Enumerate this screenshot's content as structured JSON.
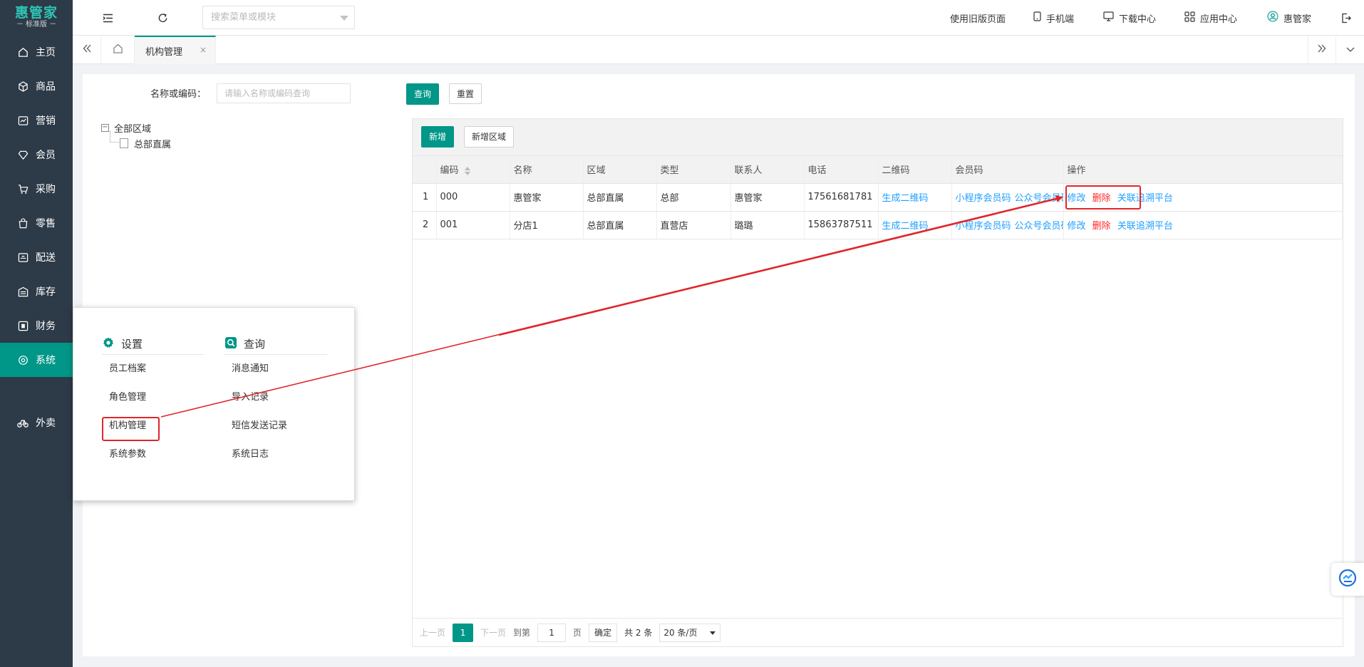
{
  "sidebar": {
    "logo": {
      "name": "惠管家",
      "edition": "－ 标准版 －"
    },
    "items": [
      {
        "label": "主页",
        "icon": "home-icon"
      },
      {
        "label": "商品",
        "icon": "cube-icon"
      },
      {
        "label": "营销",
        "icon": "chart-icon"
      },
      {
        "label": "会员",
        "icon": "diamond-icon"
      },
      {
        "label": "采购",
        "icon": "cart-icon"
      },
      {
        "label": "零售",
        "icon": "bag-icon"
      },
      {
        "label": "配送",
        "icon": "truck-icon"
      },
      {
        "label": "库存",
        "icon": "warehouse-icon"
      },
      {
        "label": "财务",
        "icon": "finance-icon"
      },
      {
        "label": "系统",
        "icon": "system-icon"
      },
      {
        "label": "外卖",
        "icon": "bike-icon"
      }
    ]
  },
  "topbar": {
    "search_placeholder": "搜索菜单或模块",
    "old_page": "使用旧版页面",
    "mobile": "手机端",
    "download": "下载中心",
    "apps": "应用中心",
    "user": "惠管家"
  },
  "tabs": {
    "active": "机构管理",
    "close": "×"
  },
  "filter": {
    "label": "名称或编码：",
    "placeholder": "请输入名称或编码查询",
    "query": "查询",
    "reset": "重置"
  },
  "tree": {
    "root": "全部区域",
    "child": "总部直属"
  },
  "toolbar": {
    "add": "新增",
    "add_region": "新增区域"
  },
  "table": {
    "headers": [
      "",
      "编码",
      "名称",
      "区域",
      "类型",
      "联系人",
      "电话",
      "二维码",
      "会员码",
      "操作"
    ],
    "rows": [
      {
        "idx": "1",
        "code": "000",
        "name": "惠管家",
        "region": "总部直属",
        "type": "总部",
        "contact": "惠管家",
        "phone": "17561681781",
        "qr": "生成二维码",
        "mini": "小程序会员码",
        "official": "公众号会员码",
        "edit": "修改",
        "delete": "删除",
        "link": "关联追溯平台"
      },
      {
        "idx": "2",
        "code": "001",
        "name": "分店1",
        "region": "总部直属",
        "type": "直营店",
        "contact": "璐璐",
        "phone": "15863787511",
        "qr": "生成二维码",
        "mini": "小程序会员码",
        "official": "公众号会员码",
        "edit": "修改",
        "delete": "删除",
        "link": "关联追溯平台"
      }
    ]
  },
  "pager": {
    "prev": "上一页",
    "current": "1",
    "next": "下一页",
    "goto": "到第",
    "page_input": "1",
    "page_unit": "页",
    "confirm": "确定",
    "total": "共 2 条",
    "per_page": "20 条/页"
  },
  "popup": {
    "settings": {
      "title": "设置",
      "items": [
        "员工档案",
        "角色管理",
        "机构管理",
        "系统参数"
      ]
    },
    "query": {
      "title": "查询",
      "items": [
        "消息通知",
        "导入记录",
        "短信发送记录",
        "系统日志"
      ]
    }
  },
  "colors": {
    "accent": "#009688",
    "sidebar": "#2d3a47",
    "link": "#1e9fff",
    "danger": "#ff2b2b",
    "annotation": "#e0262b"
  }
}
